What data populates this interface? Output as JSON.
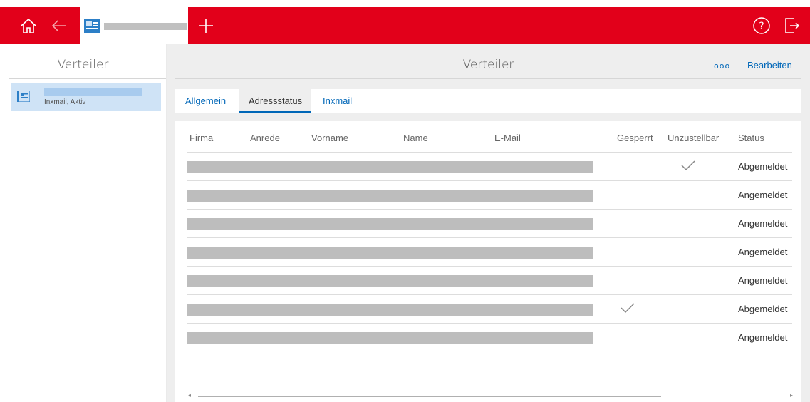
{
  "topbar": {
    "color": "#e2001a",
    "icons": [
      "home-icon",
      "back-arrow-icon",
      "add-tab-icon",
      "help-icon",
      "logout-icon"
    ]
  },
  "left_panel": {
    "title": "Verteiler",
    "item": {
      "subtitle": "Inxmail, Aktiv",
      "icon": "distribution-list-icon"
    }
  },
  "main": {
    "title": "Verteiler",
    "more_label": "ooo",
    "edit_label": "Bearbeiten",
    "tabs": [
      {
        "label": "Allgemein",
        "active": false
      },
      {
        "label": "Adressstatus",
        "active": true
      },
      {
        "label": "Inxmail",
        "active": false
      }
    ],
    "table": {
      "columns": [
        "Firma",
        "Anrede",
        "Vorname",
        "Name",
        "E-Mail",
        "Gesperrt",
        "Unzustellbar",
        "Status"
      ],
      "rows": [
        {
          "gesperrt": false,
          "unzustellbar": true,
          "status": "Abgemeldet"
        },
        {
          "gesperrt": false,
          "unzustellbar": false,
          "status": "Angemeldet"
        },
        {
          "gesperrt": false,
          "unzustellbar": false,
          "status": "Angemeldet"
        },
        {
          "gesperrt": false,
          "unzustellbar": false,
          "status": "Angemeldet"
        },
        {
          "gesperrt": false,
          "unzustellbar": false,
          "status": "Angemeldet"
        },
        {
          "gesperrt": true,
          "unzustellbar": false,
          "status": "Abgemeldet"
        },
        {
          "gesperrt": false,
          "unzustellbar": false,
          "status": "Angemeldet"
        }
      ]
    }
  }
}
